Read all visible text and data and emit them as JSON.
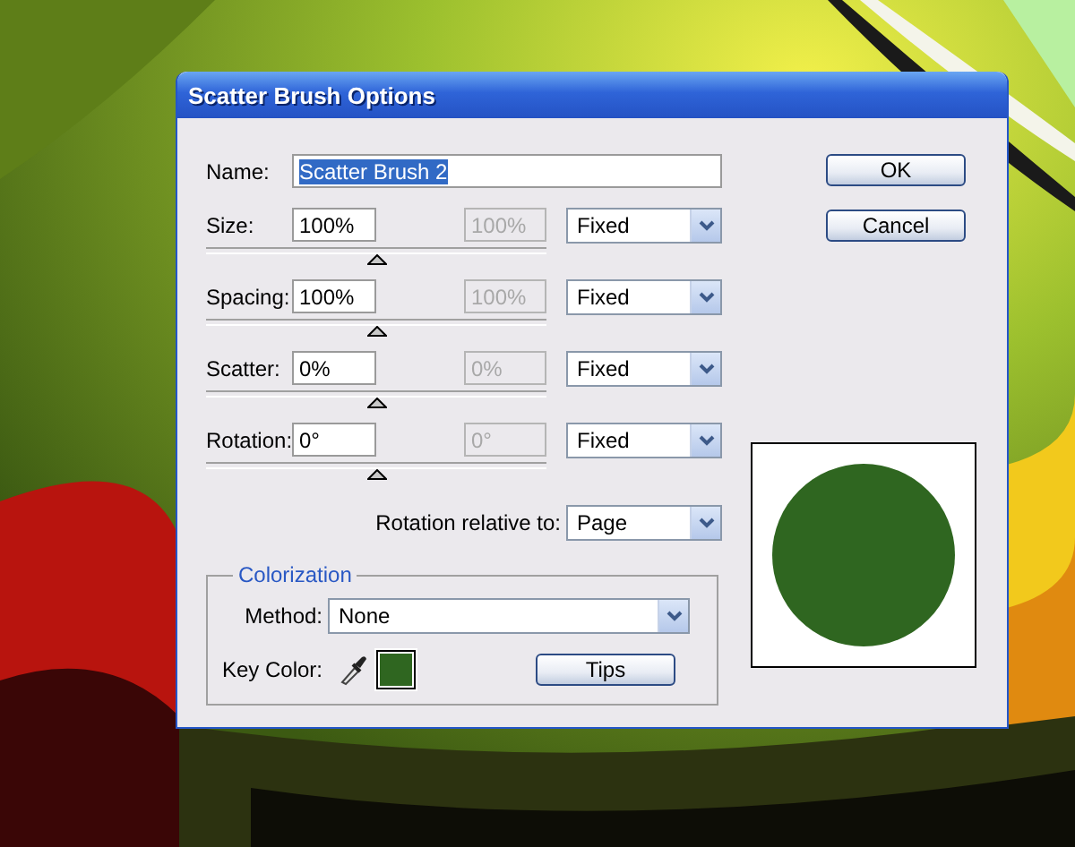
{
  "window": {
    "title": "Scatter Brush Options"
  },
  "name": {
    "label": "Name:",
    "value": "Scatter Brush 2",
    "selected": true
  },
  "parameters": [
    {
      "label": "Size:",
      "value": "100%",
      "second_value": "100%",
      "second_disabled": true,
      "variation": "Fixed",
      "level": 0.5
    },
    {
      "label": "Spacing:",
      "value": "100%",
      "second_value": "100%",
      "second_disabled": true,
      "variation": "Fixed",
      "level": 0.5
    },
    {
      "label": "Scatter:",
      "value": "0%",
      "second_value": "0%",
      "second_disabled": true,
      "variation": "Fixed",
      "level": 0.5
    },
    {
      "label": "Rotation:",
      "value": "0°",
      "second_value": "0°",
      "second_disabled": true,
      "variation": "Fixed",
      "level": 0.5
    }
  ],
  "rotation_relative": {
    "label": "Rotation relative to:",
    "value": "Page"
  },
  "colorization": {
    "title": "Colorization",
    "method_label": "Method:",
    "method": "None",
    "key_color_label": "Key Color:",
    "key_color_swatch": {
      "color": "#2f6620"
    },
    "tips_button": "Tips"
  },
  "buttons": [
    "OK",
    "Cancel"
  ],
  "preview": {
    "color": "#2f6620"
  }
}
